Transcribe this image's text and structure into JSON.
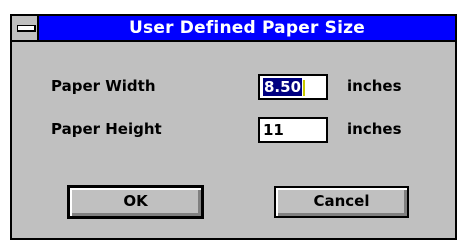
{
  "window": {
    "title": "User Defined Paper Size"
  },
  "fields": {
    "width": {
      "label": "Paper Width",
      "value": "8.50",
      "unit": "inches"
    },
    "height": {
      "label": "Paper Height",
      "value": "11",
      "unit": "inches"
    }
  },
  "buttons": {
    "ok": "OK",
    "cancel": "Cancel"
  },
  "colors": {
    "titlebar": "#0000ff",
    "dialog_bg": "#c0c0c0"
  }
}
